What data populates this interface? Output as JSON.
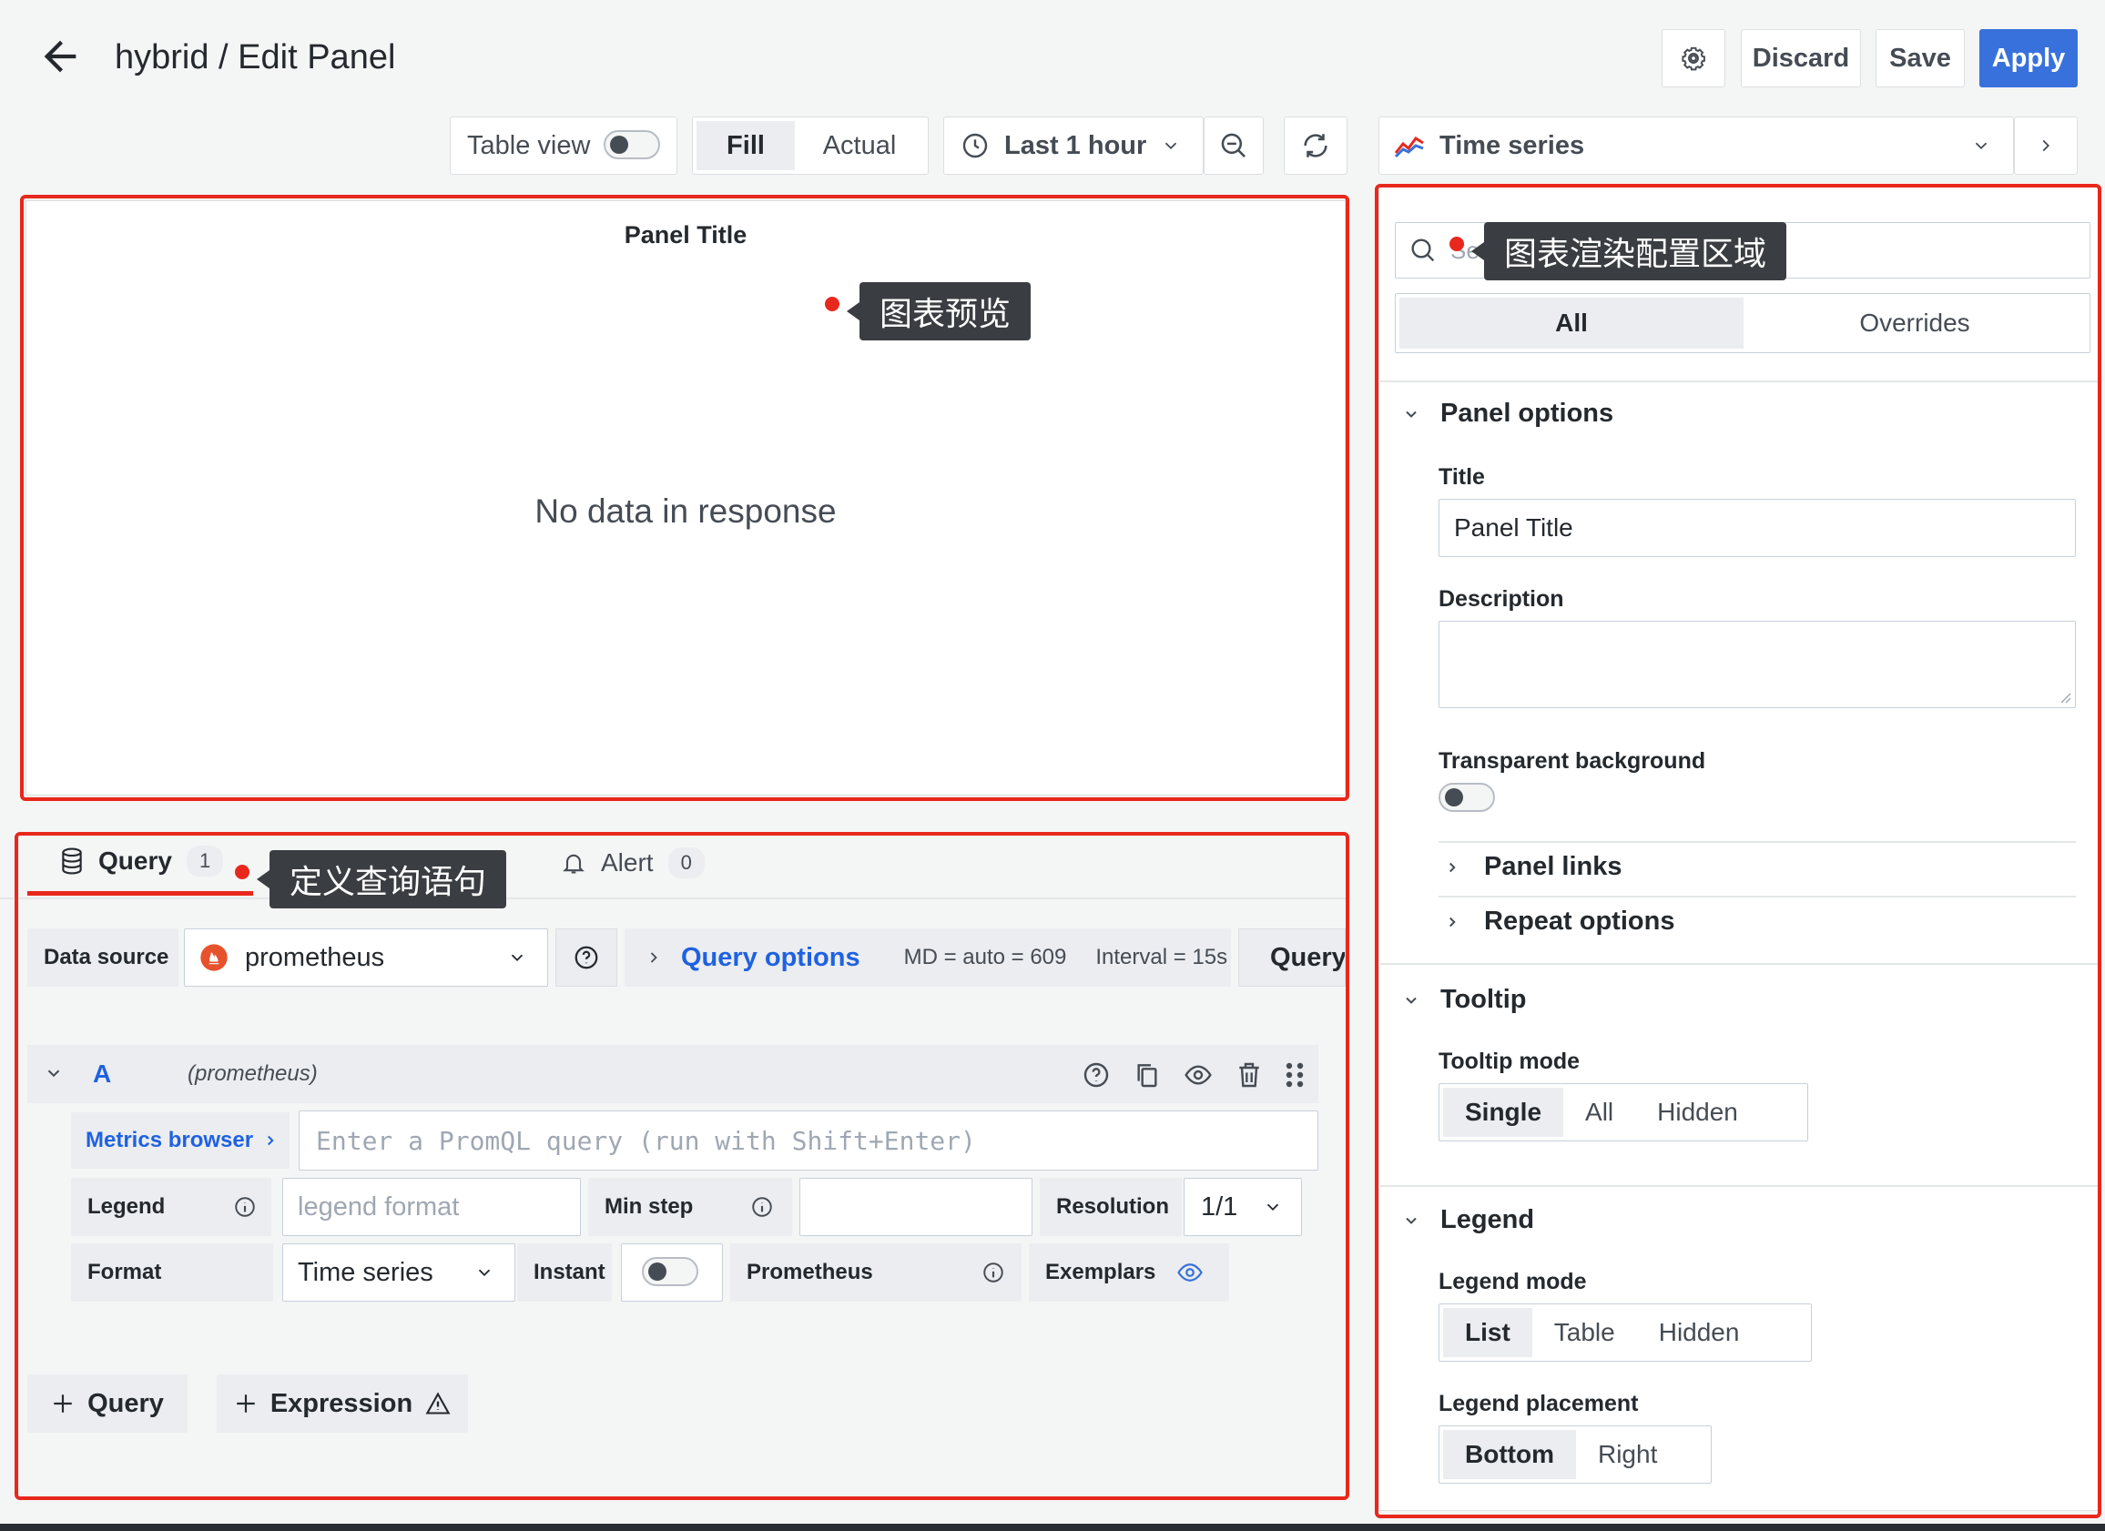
{
  "header": {
    "title": "hybrid / Edit Panel",
    "discard": "Discard",
    "save": "Save",
    "apply": "Apply"
  },
  "toolbar": {
    "table_view": "Table view",
    "fill": "Fill",
    "actual": "Actual",
    "time_range": "Last 1 hour",
    "visualization": "Time series"
  },
  "preview": {
    "panel_title": "Panel Title",
    "empty": "No data in response"
  },
  "annotations": {
    "preview": "图表预览",
    "query": "定义查询语句",
    "options": "图表渲染配置区域"
  },
  "query_tabs": {
    "query_label": "Query",
    "query_count": "1",
    "alert_label": "Alert",
    "alert_count": "0"
  },
  "datasource": {
    "label": "Data source",
    "value": "prometheus",
    "query_options": "Query options",
    "md": "MD = auto = 609",
    "interval": "Interval = 15s",
    "inspector": "Query"
  },
  "query_row": {
    "letter": "A",
    "source": "(prometheus)",
    "metrics_browser": "Metrics browser",
    "placeholder": "Enter a PromQL query (run with Shift+Enter)",
    "legend": "Legend",
    "legend_placeholder": "legend format",
    "min_step": "Min step",
    "resolution": "Resolution",
    "resolution_value": "1/1",
    "format": "Format",
    "format_value": "Time series",
    "instant": "Instant",
    "prometheus": "Prometheus",
    "exemplars": "Exemplars"
  },
  "add_buttons": {
    "query": "Query",
    "expression": "Expression"
  },
  "options": {
    "search_placeholder": "Search",
    "tab_all": "All",
    "tab_overrides": "Overrides",
    "panel_options": "Panel options",
    "title_label": "Title",
    "title_value": "Panel Title",
    "description_label": "Description",
    "transparent_label": "Transparent background",
    "panel_links": "Panel links",
    "repeat_options": "Repeat options",
    "tooltip": "Tooltip",
    "tooltip_mode": "Tooltip mode",
    "tooltip_opts": [
      "Single",
      "All",
      "Hidden"
    ],
    "legend": "Legend",
    "legend_mode": "Legend mode",
    "legend_opts": [
      "List",
      "Table",
      "Hidden"
    ],
    "legend_placement": "Legend placement",
    "placement_opts": [
      "Bottom",
      "Right"
    ]
  },
  "colors": {
    "accent": "#3871dc",
    "annotation_red": "#e8281c",
    "link_blue": "#1f62e0"
  }
}
